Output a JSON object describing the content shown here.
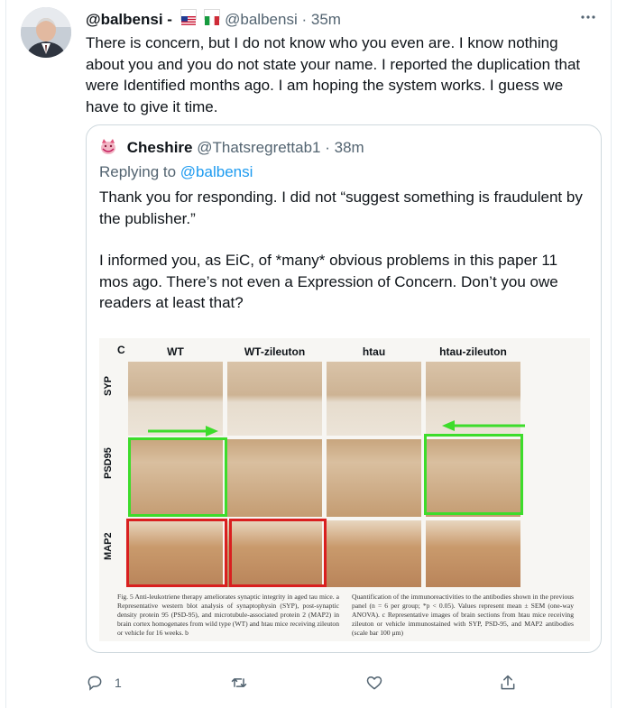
{
  "tweet": {
    "display_name": "@balbensi -",
    "handle": "@balbensi",
    "time": "35m",
    "flags": [
      "us-flag",
      "italy-flag"
    ],
    "text": "There is concern, but I do not know who you even are. I know nothing about you and you do not state your name. I reported the duplication that were Identified months ago. I am hoping the system works. I guess we have to give it time.",
    "more_icon": "more-icon"
  },
  "quote": {
    "display_name": "Cheshire",
    "handle": "@Thatsregrettab1",
    "time": "38m",
    "reply_prefix": "Replying to",
    "reply_to": "@balbensi",
    "paragraph1": "Thank you for responding. I did not “suggest something is fraudulent by the publisher.”",
    "paragraph2": "I informed you, as EiC, of *many* obvious problems in this paper 11 mos ago. There’s not even a Expression of Concern. Don’t you owe readers at least that?"
  },
  "figure": {
    "panel_letter": "C",
    "columns": [
      "WT",
      "WT-zileuton",
      "htau",
      "htau-zileuton"
    ],
    "rows": [
      "SYP",
      "PSD95",
      "MAP2"
    ],
    "highlight_colors": {
      "green": "#3ddc2b",
      "red": "#d91f1f"
    },
    "caption_left": "Fig. 5 Anti-leukotriene therapy ameliorates synaptic integrity in aged tau mice. a Representative western blot analysis of synaptophysin (SYP), post-synaptic density protein 95 (PSD-95), and microtubule-associated protein 2 (MAP2) in brain cortex homogenates from wild type (WT) and htau mice receiving zileuton or vehicle for 16 weeks. b",
    "caption_right": "Quantification of the immunoreactivities to the antibodies shown in the previous panel (n = 6 per group; *p < 0.05). Values represent mean ± SEM (one-way ANOVA). c Representative images of brain sections from htau mice receiving zileuton or vehicle immunostained with SYP, PSD-95, and MAP2 antibodies (scale bar 100 μm)"
  },
  "actions": {
    "reply_count": "1",
    "retweet_count": "",
    "like_count": "",
    "icons": [
      "reply-icon",
      "retweet-icon",
      "like-icon",
      "share-icon"
    ]
  }
}
